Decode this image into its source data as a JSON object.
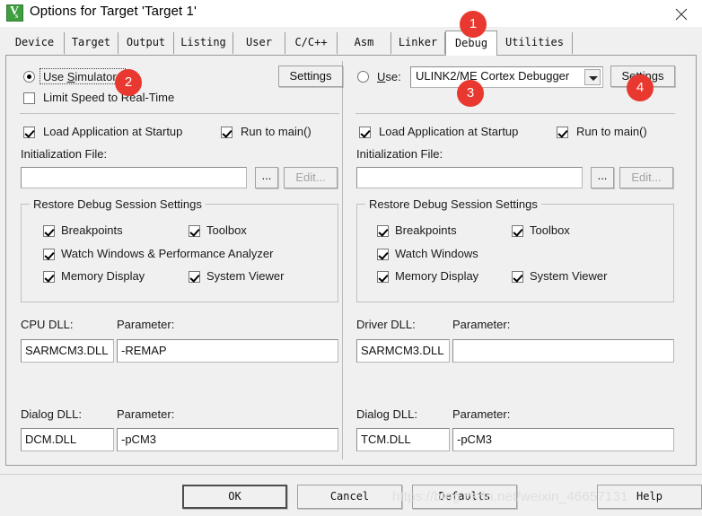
{
  "window": {
    "title": "Options for Target 'Target 1'",
    "app_icon": "uvision-logo-icon",
    "close_label": "✕"
  },
  "tabs": [
    {
      "label": "Device",
      "selected": false
    },
    {
      "label": "Target",
      "selected": false
    },
    {
      "label": "Output",
      "selected": false
    },
    {
      "label": "Listing",
      "selected": false
    },
    {
      "label": "User",
      "selected": false
    },
    {
      "label": "C/C++",
      "selected": false
    },
    {
      "label": "Asm",
      "selected": false
    },
    {
      "label": "Linker",
      "selected": false
    },
    {
      "label": "Debug",
      "selected": true
    },
    {
      "label": "Utilities",
      "selected": false
    }
  ],
  "left_panel": {
    "mode_label_pre": "Use ",
    "mode_label_accel": "S",
    "mode_label_post": "imulator",
    "mode_selected": true,
    "limit_speed_label": "Limit Speed to Real-Time",
    "limit_speed_checked": false,
    "settings_label": "Settings",
    "load_app_label": "Load Application at Startup",
    "load_app_checked": true,
    "run_to_main_label": "Run to main()",
    "run_to_main_checked": true,
    "init_file_label": "Initialization File:",
    "init_file_value": "",
    "browse_label": "...",
    "edit_label": "Edit...",
    "edit_enabled": false,
    "restore_group_title": "Restore Debug Session Settings",
    "restore_items": [
      {
        "label": "Breakpoints",
        "checked": true
      },
      {
        "label": "Toolbox",
        "checked": true
      },
      {
        "label": "Watch Windows & Performance Analyzer",
        "checked": true
      },
      {
        "label": "Memory Display",
        "checked": true
      },
      {
        "label": "System Viewer",
        "checked": true
      }
    ],
    "cpu_dll_label": "CPU DLL:",
    "cpu_dll_value": "SARMCM3.DLL",
    "cpu_param_label": "Parameter:",
    "cpu_param_value": "-REMAP",
    "dialog_dll_label": "Dialog DLL:",
    "dialog_dll_value": "DCM.DLL",
    "dialog_param_label": "Parameter:",
    "dialog_param_value": "-pCM3"
  },
  "right_panel": {
    "mode_label_pre": "",
    "mode_label_accel": "U",
    "mode_label_post": "se:",
    "mode_selected": false,
    "debugger_selected": "ULINK2/ME Cortex Debugger",
    "settings_label": "Settings",
    "load_app_label": "Load Application at Startup",
    "load_app_checked": true,
    "run_to_main_label": "Run to main()",
    "run_to_main_checked": true,
    "init_file_label": "Initialization File:",
    "init_file_value": "",
    "browse_label": "...",
    "edit_label": "Edit...",
    "edit_enabled": false,
    "restore_group_title": "Restore Debug Session Settings",
    "restore_items": [
      {
        "label": "Breakpoints",
        "checked": true
      },
      {
        "label": "Toolbox",
        "checked": true
      },
      {
        "label": "Watch Windows",
        "checked": true
      },
      {
        "label": "Memory Display",
        "checked": true
      },
      {
        "label": "System Viewer",
        "checked": true
      }
    ],
    "driver_dll_label": "Driver DLL:",
    "driver_dll_value": "SARMCM3.DLL",
    "driver_param_label": "Parameter:",
    "driver_param_value": "",
    "dialog_dll_label": "Dialog DLL:",
    "dialog_dll_value": "TCM.DLL",
    "dialog_param_label": "Parameter:",
    "dialog_param_value": "-pCM3"
  },
  "footer": {
    "ok_label": "OK",
    "cancel_label": "Cancel",
    "defaults_label": "Defaults",
    "help_label": "Help"
  },
  "annotations": [
    {
      "number": "1"
    },
    {
      "number": "2"
    },
    {
      "number": "3"
    },
    {
      "number": "4"
    }
  ],
  "watermark": {
    "text": "https://blog.csdn.net/weixin_46657131"
  },
  "colors": {
    "badge": "#e8382f",
    "dialog_bg": "#f0f0f0",
    "titlebar_bg": "#ffffff",
    "field_bg": "#ffffff",
    "icon_green": "#3f9e3f"
  }
}
